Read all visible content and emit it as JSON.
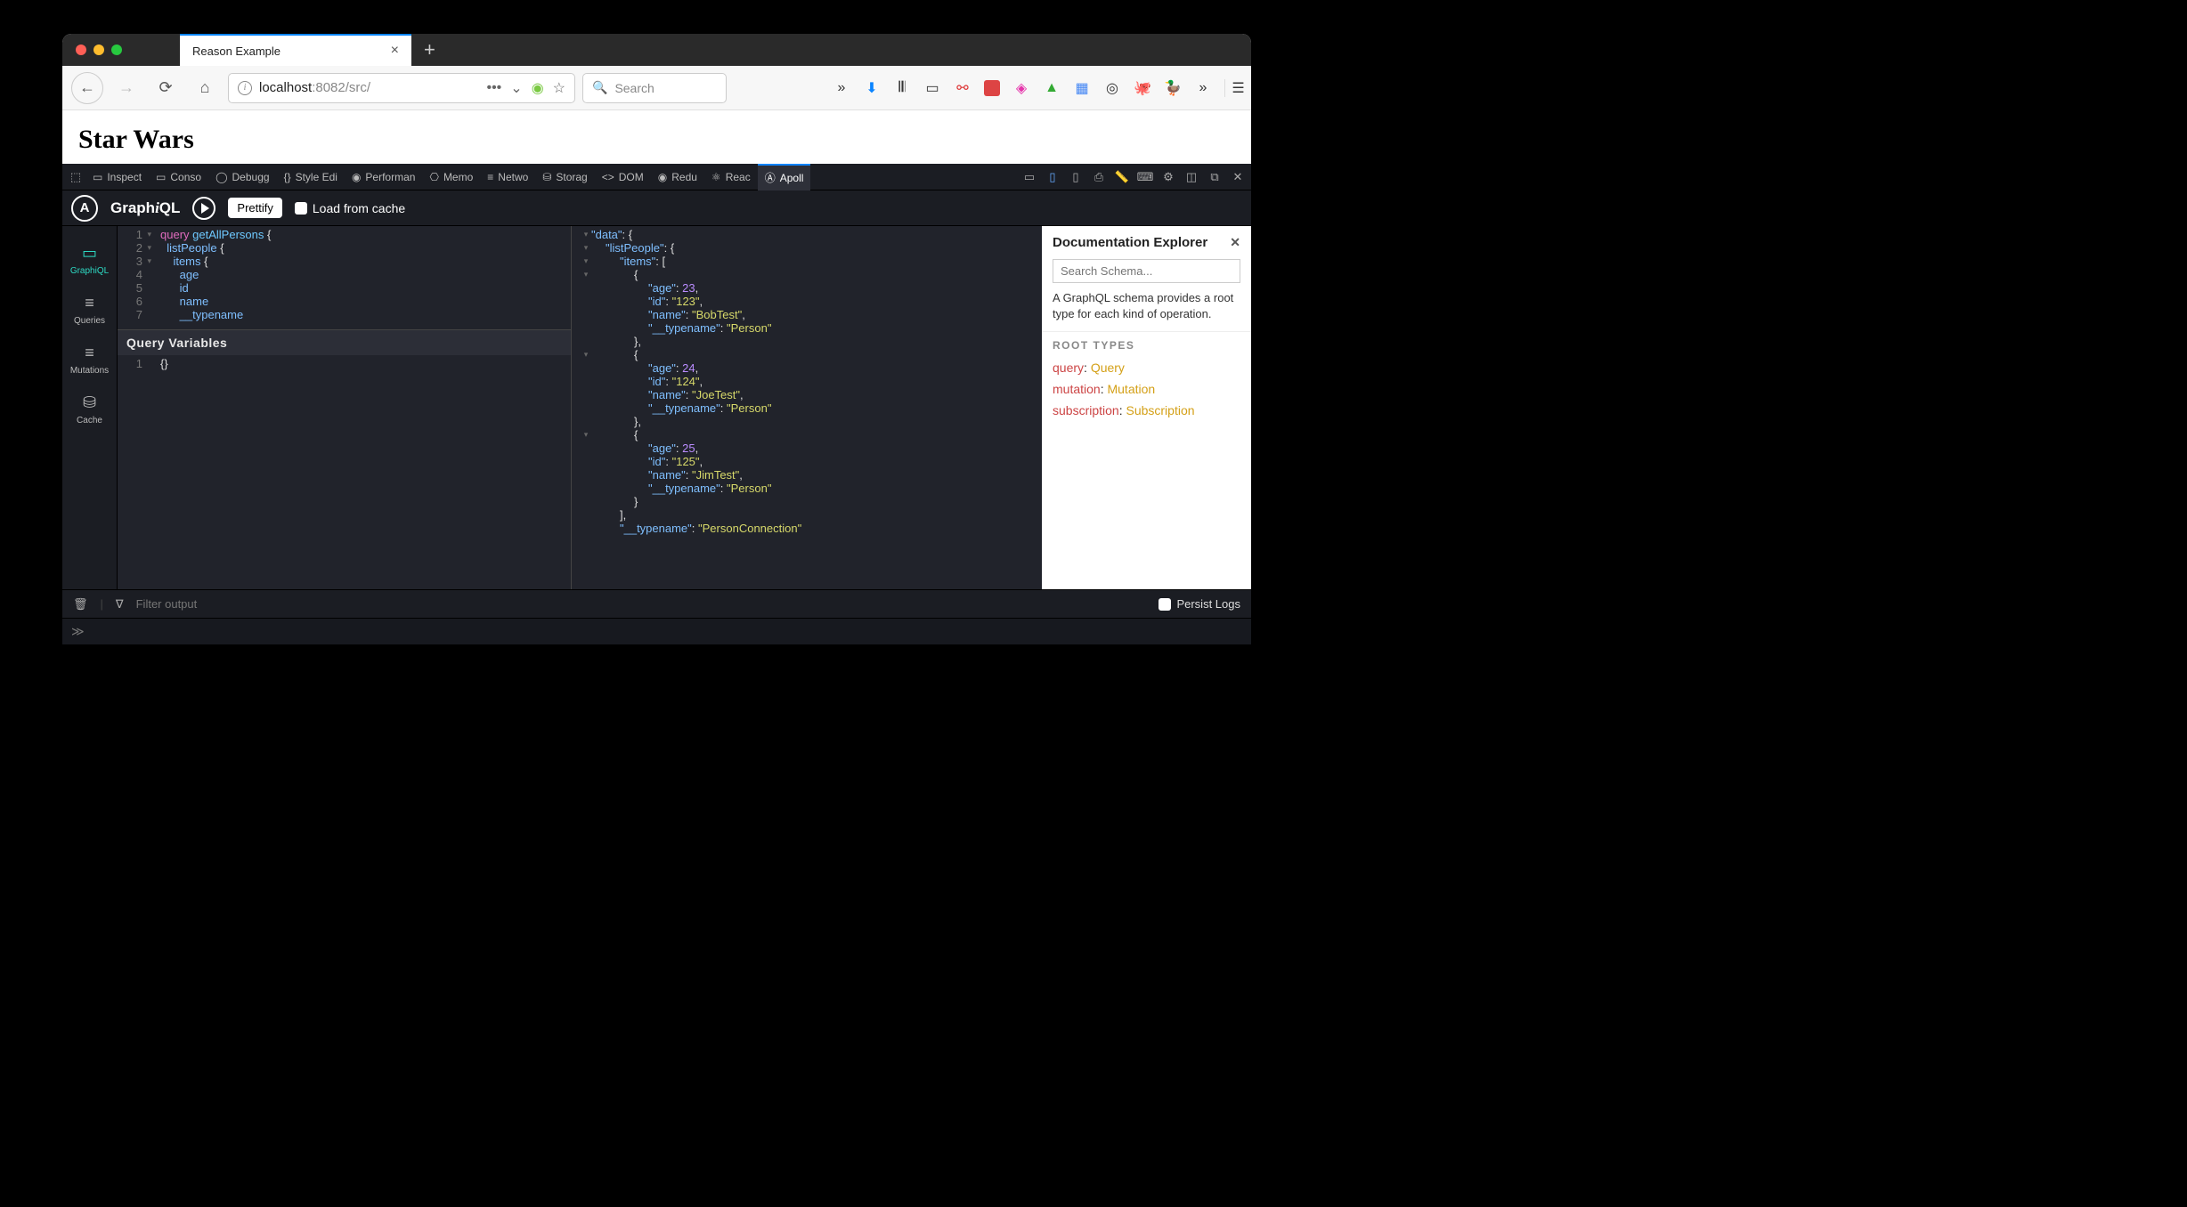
{
  "tab": {
    "title": "Reason Example"
  },
  "url": {
    "host": "localhost",
    "port": ":8082",
    "path": "/src/"
  },
  "search": {
    "placeholder": "Search"
  },
  "page": {
    "heading": "Star Wars"
  },
  "devtools_tabs": [
    "Inspect",
    "Conso",
    "Debugg",
    "Style Edi",
    "Performan",
    "Memo",
    "Netwo",
    "Storag",
    "DOM",
    "Redu",
    "Reac",
    "Apoll"
  ],
  "apollo": {
    "logo": "A",
    "brand": "GraphiQL",
    "prettify": "Prettify",
    "load_from_cache": "Load from cache"
  },
  "sidebar": {
    "items": [
      {
        "icon": "▭",
        "label": "GraphiQL"
      },
      {
        "icon": "≡",
        "label": "Queries"
      },
      {
        "icon": "≡",
        "label": "Mutations"
      },
      {
        "icon": "⛁",
        "label": "Cache"
      }
    ]
  },
  "query": {
    "lines": [
      {
        "n": 1,
        "fold": true,
        "html": "<span class='kw'>query</span> <span class='fn'>getAllPersons</span> <span class='br'>{</span>"
      },
      {
        "n": 2,
        "fold": true,
        "html": "  <span class='prop'>listPeople</span> <span class='br'>{</span>"
      },
      {
        "n": 3,
        "fold": true,
        "html": "    <span class='prop'>items</span> <span class='br'>{</span>"
      },
      {
        "n": 4,
        "html": "      <span class='prop'>age</span>"
      },
      {
        "n": 5,
        "html": "      <span class='prop'>id</span>"
      },
      {
        "n": 6,
        "html": "      <span class='prop'>name</span>"
      },
      {
        "n": 7,
        "html": "      <span class='prop'>__typename</span>"
      }
    ]
  },
  "qv": {
    "header": "Query Variables",
    "content": "{}"
  },
  "result": {
    "data": {
      "listPeople": {
        "items": [
          {
            "age": 23,
            "id": "123",
            "name": "BobTest",
            "__typename": "Person"
          },
          {
            "age": 24,
            "id": "124",
            "name": "JoeTest",
            "__typename": "Person"
          },
          {
            "age": 25,
            "id": "125",
            "name": "JimTest",
            "__typename": "Person"
          }
        ],
        "__typename": "PersonConnection"
      }
    }
  },
  "docs": {
    "title": "Documentation Explorer",
    "search_ph": "Search Schema...",
    "desc": "A GraphQL schema provides a root type for each kind of operation.",
    "section": "ROOT TYPES",
    "roots": [
      {
        "field": "query",
        "type": "Query"
      },
      {
        "field": "mutation",
        "type": "Mutation"
      },
      {
        "field": "subscription",
        "type": "Subscription"
      }
    ]
  },
  "footer": {
    "filter_ph": "Filter output",
    "persist": "Persist Logs"
  }
}
